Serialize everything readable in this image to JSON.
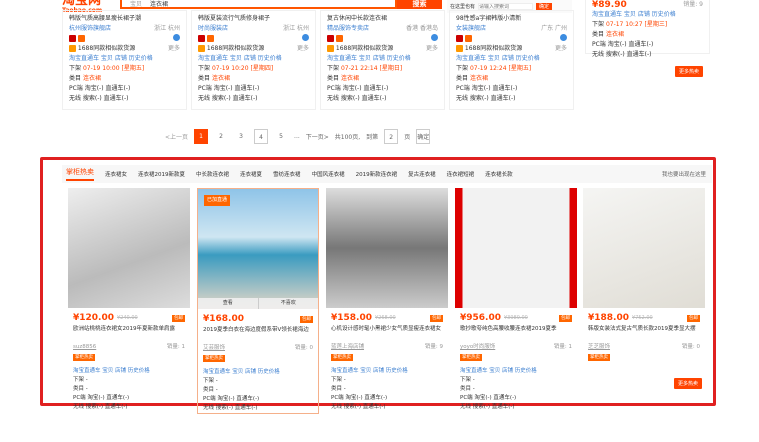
{
  "header": {
    "logo": "淘宝网",
    "logo_sub": "Taobao.com",
    "scope": "宝贝",
    "query": "连衣裙",
    "search_btn": "搜索",
    "slot_label": "在这里也有",
    "slot_placeholder": "请输入搜索词",
    "slot_btn": "确定"
  },
  "top_cards": [
    {
      "title": "韩版气质高腰显瘦长裙子潮",
      "shop": "杭州服饰旗舰店",
      "loc": "浙江 杭州",
      "more": "更多",
      "promo": "1688同款相似款货源",
      "links": "淘宝直通车 宝贝 店铺 历史价格",
      "down": "下架",
      "down_v": "07-19 10:00 [星期五]",
      "cat": "类目",
      "cat_v": "连衣裙",
      "pc": "PC端 淘宝(-) 直通车(-)",
      "wx": "无线 搜索(-) 直通车(-)"
    },
    {
      "title": "韩版夏装流行气质修身裙子",
      "shop": "时尚服装店",
      "loc": "浙江 杭州",
      "more": "更多",
      "promo": "1688同款相似款货源",
      "links": "淘宝直通车 宝贝 店铺 历史价格",
      "down": "下架",
      "down_v": "07-19 10:20 [星期四]",
      "cat": "类目",
      "cat_v": "连衣裙",
      "pc": "PC端 淘宝(-) 直通车(-)",
      "wx": "无线 搜索(-) 直通车(-)"
    },
    {
      "title": "复古休闲中长款连衣裙",
      "shop": "精品服饰专卖店",
      "loc": "香港 香港岛",
      "more": "更多",
      "promo": "1688同款相似款货源",
      "links": "淘宝直通车 宝贝 店铺 历史价格",
      "down": "下架",
      "down_v": "07-21 22:14 [星期日]",
      "cat": "类目",
      "cat_v": "连衣裙",
      "pc": "PC端 淘宝(-) 直通车(-)",
      "wx": "无线 搜索(-) 直通车(-)"
    },
    {
      "title": "98性感a字裙韩版小清新",
      "shop": "女装旗舰店",
      "loc": "广东 广州",
      "more": "更多",
      "promo": "1688同款相似款货源",
      "links": "淘宝直通车 宝贝 店铺 历史价格",
      "down": "下架",
      "down_v": "07-19 12:24 [星期五]",
      "cat": "类目",
      "cat_v": "连衣裙",
      "pc": "PC端 淘宝(-) 直通车(-)",
      "wx": "无线 搜索(-) 直通车(-)"
    }
  ],
  "right_card": {
    "price": "¥89.90",
    "sales": "销量: 9",
    "links": "淘宝直通车 宝贝 店铺 历史价格",
    "down": "下架",
    "down_v": "07-17 10:27 [星期三]",
    "cat": "类目",
    "cat_v": "连衣裙",
    "pc": "PC端 淘宝(-) 直通车(-)",
    "wx": "无线 搜索(-) 直通车(-)"
  },
  "more_hot": "更多热卖",
  "pager": {
    "prev": "<上一页",
    "pages": [
      "1",
      "2",
      "3",
      "4",
      "5"
    ],
    "ellipsis": "...",
    "next": "下一页>",
    "total": "共100页,",
    "goto": "到第",
    "goto_value": "2",
    "unit": "页",
    "confirm": "确定"
  },
  "hot": {
    "tabs": [
      "掌柜热卖",
      "连衣裙女",
      "连衣裙2019新款夏",
      "中长款连衣裙",
      "连衣裙夏",
      "雪纺连衣裙",
      "中国风连衣裙",
      "2019新款连衣裙",
      "复古连衣裙",
      "连衣裙短裙",
      "连衣裙长款"
    ],
    "right": "我也要出现在这里",
    "overlay": [
      "查看",
      "不喜欢"
    ],
    "products": [
      {
        "price": "¥120.00",
        "old": "¥240.00",
        "tag": "包邮",
        "title": "欧洲站桃桃连衣裙女2019年夏新款单肩露",
        "shop": "suz8856",
        "sales": "销量: 1",
        "badge": "掌柜热卖",
        "links": "淘宝直通车 宝贝 店铺 历史价格",
        "down": "下架 -",
        "cat": "类目 -",
        "pc": "PC端 淘宝(-) 直通车(-)",
        "wx": "无线 搜索(-) 直通车(-)"
      },
      {
        "price": "¥168.00",
        "old": "",
        "tag": "包邮",
        "title": "2019夏季白衣在海边度假系带V领长裙海边",
        "shop": "艾芸服饰",
        "sales": "销量: 0",
        "badge": "掌柜热卖",
        "links": "淘宝直通车 宝贝 店铺 历史价格",
        "down": "下架 -",
        "cat": "类目 -",
        "pc": "PC端 淘宝(-) 直通车(-)",
        "wx": "无线 搜索(-) 直通车(-)",
        "img_tag": "已加直通"
      },
      {
        "price": "¥158.00",
        "old": "¥268.00",
        "tag": "包邮",
        "title": "心机设计感时髦小黑裙少女气质显瘦连衣裙女",
        "shop": "蓝莲上海店铺",
        "sales": "销量: 9",
        "badge": "掌柜热卖",
        "links": "淘宝直通车 宝贝 店铺 历史价格",
        "down": "下架 -",
        "cat": "类目 -",
        "pc": "PC端 淘宝(-) 直通车(-)",
        "wx": "无线 搜索(-) 直通车(-)"
      },
      {
        "price": "¥956.00",
        "old": "¥3989.00",
        "tag": "包邮",
        "title": "歌抄歌夸纯色高腰收腰连衣裙2019夏季",
        "shop": "yoyo时尚服饰",
        "sales": "销量: 1",
        "badge": "掌柜热卖",
        "links": "淘宝直通车 宝贝 店铺 历史价格",
        "down": "下架 -",
        "cat": "类目 -",
        "pc": "PC端 淘宝(-) 直通车(-)",
        "wx": "无线 搜索(-) 直通车(-)"
      },
      {
        "price": "¥188.00",
        "old": "¥752.00",
        "tag": "包邮",
        "title": "韩版女装法式复古气质长款2019夏季显大摆",
        "shop": "芝芝服饰",
        "sales": "销量: 0",
        "badge": "掌柜热卖"
      }
    ]
  },
  "colors": {
    "accent": "#ff4400",
    "highlight": "#e02020",
    "link": "#3c7fd0"
  }
}
